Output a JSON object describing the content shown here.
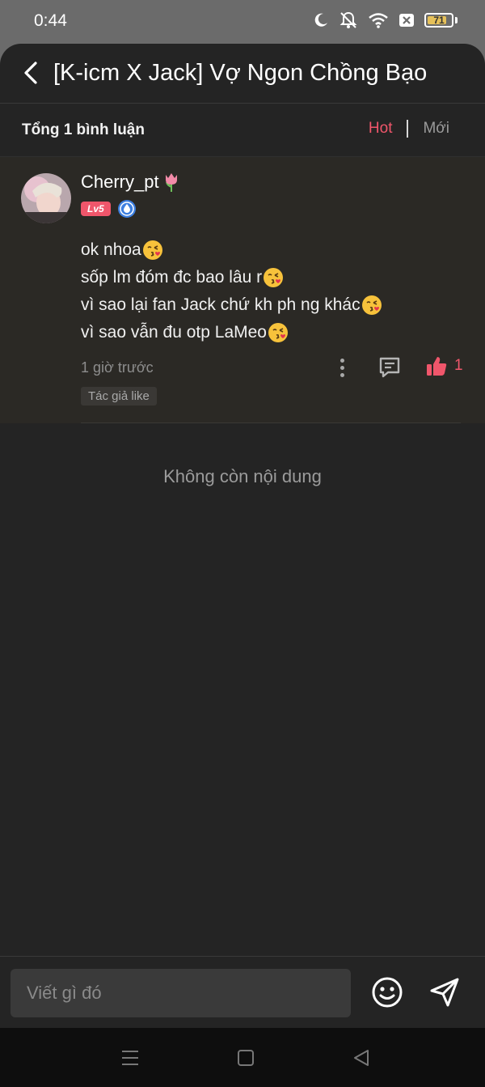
{
  "status_bar": {
    "time": "0:44",
    "battery": "71",
    "icons": [
      "moon-icon",
      "bell-off-icon",
      "wifi-icon",
      "sim-x-icon",
      "battery-icon"
    ]
  },
  "header": {
    "title": "[K-icm X Jack] Vợ Ngon Chồng Bạo",
    "back_icon": "chevron-left-icon"
  },
  "comments_bar": {
    "total": "Tổng 1 bình luận",
    "tabs": {
      "hot": "Hot",
      "new": "Mới"
    },
    "active_tab_color": "#f0566b"
  },
  "comment": {
    "username": "Cherry_pt",
    "username_emoji": "tulip-icon",
    "level": "Lv5",
    "verified_icon": "shield-drop-icon",
    "lines": [
      "ok nhoa",
      "sốp lm đóm đc bao lâu r",
      "vì sao lại fan Jack chứ kh ph ng khác",
      "vì sao vẫn đu otp LaMeo"
    ],
    "line_emoji": "kissing-face-icon",
    "time": "1 giờ trước",
    "like_count": "1",
    "author_tag": "Tác giả like"
  },
  "empty_message": "Không còn nội dung",
  "input": {
    "placeholder": "Viết gì đó"
  },
  "colors": {
    "accent": "#f0566b",
    "background": "#242424",
    "comment_bg": "#2b2925"
  }
}
